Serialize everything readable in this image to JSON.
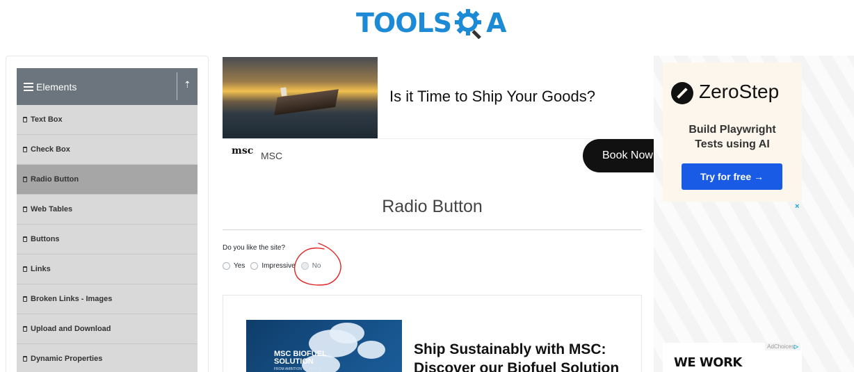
{
  "header": {
    "logo_text_left": "TOOLS",
    "logo_text_right": "A"
  },
  "sidebar": {
    "group_title": "Elements",
    "items": [
      {
        "label": "Text Box",
        "active": false
      },
      {
        "label": "Check Box",
        "active": false
      },
      {
        "label": "Radio Button",
        "active": true
      },
      {
        "label": "Web Tables",
        "active": false
      },
      {
        "label": "Buttons",
        "active": false
      },
      {
        "label": "Links",
        "active": false
      },
      {
        "label": "Broken Links - Images",
        "active": false
      },
      {
        "label": "Upload and Download",
        "active": false
      },
      {
        "label": "Dynamic Properties",
        "active": false
      }
    ]
  },
  "ad_top": {
    "headline": "Is it Time to Ship Your Goods?",
    "advertiser": "MSC",
    "logo": "msc",
    "cta": "Book Now"
  },
  "main": {
    "title": "Radio Button",
    "question": "Do you like the site?",
    "options": [
      {
        "label": "Yes",
        "disabled": false
      },
      {
        "label": "Impressive",
        "disabled": false
      },
      {
        "label": "No",
        "disabled": true
      }
    ]
  },
  "ad_bottom": {
    "image_title": "MSC BIOFUEL SOLUTION",
    "image_sub": "FROM AMBITION TO ACTION",
    "headline": "Ship Sustainably with MSC: Discover our Biofuel Solution"
  },
  "right_ad": {
    "brand": "ZeroStep",
    "tagline": "Build Playwright Tests using AI",
    "cta": "Try for free →",
    "close": "×",
    "adchoices": "AdChoices",
    "banner2": "WE WORK REMOTELY"
  },
  "colors": {
    "accent": "#1d8ad6",
    "sidebar_item": "#d9d9d9",
    "sidebar_active": "#a6a6a6",
    "annotation": "#e02424",
    "zs_button": "#1a5be6"
  }
}
